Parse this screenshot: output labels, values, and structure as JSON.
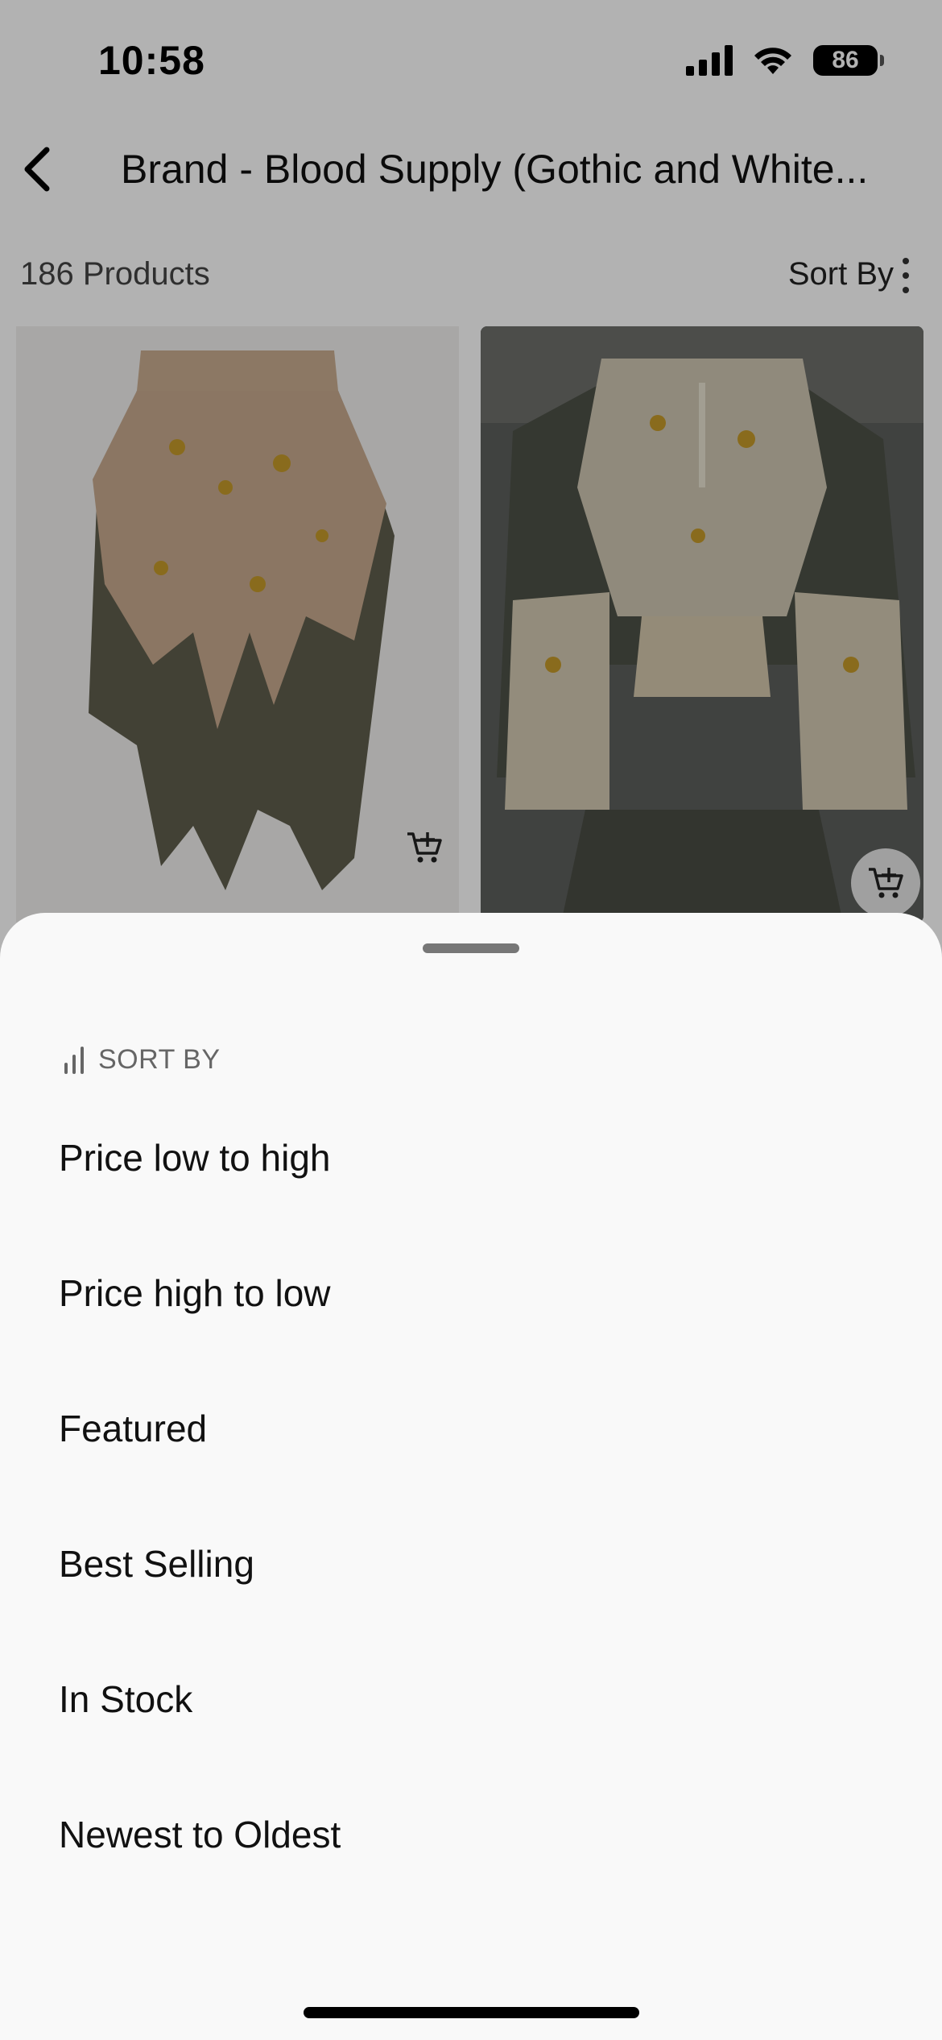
{
  "status_bar": {
    "time": "10:58",
    "battery": "86",
    "icons": [
      "signal-icon",
      "wifi-icon",
      "battery-icon"
    ]
  },
  "nav": {
    "back_icon": "chevron-left-icon",
    "title": "Brand - Blood Supply (Gothic and White..."
  },
  "list": {
    "product_count": "186 Products",
    "sort_label": "Sort By",
    "sort_icon": "kebab-menu-icon"
  },
  "products": [
    {
      "kind": "layered lace skirt",
      "cart_icon": "add-to-cart-icon"
    },
    {
      "kind": "ruffled jacket",
      "cart_icon": "add-to-cart-icon"
    }
  ],
  "sort_sheet": {
    "title": "SORT BY",
    "title_icon": "bars-icon",
    "options": [
      "Price low to high",
      "Price high to low",
      "Featured",
      "Best Selling",
      "In Stock",
      "Newest to Oldest"
    ]
  },
  "colors": {
    "scrim": "#000000",
    "sheet_bg": "#f9f9f9",
    "text": "#111111",
    "muted": "#666666"
  }
}
